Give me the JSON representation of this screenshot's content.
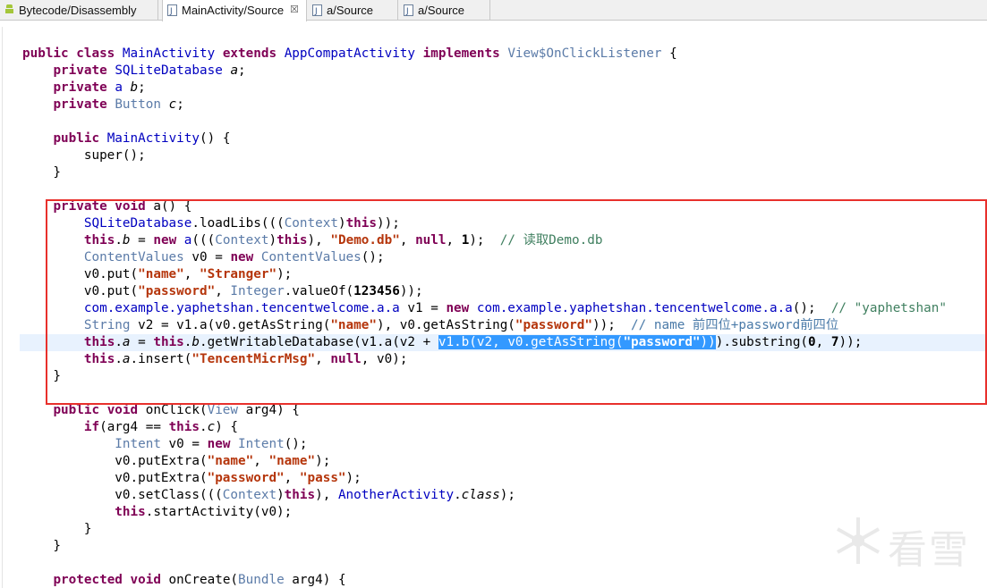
{
  "tabs": [
    {
      "label": "Bytecode/Disassembly",
      "icon": "android-icon"
    },
    {
      "label": "MainActivity/Source",
      "icon": "java-file-icon",
      "close": "☒"
    },
    {
      "label": "a/Source",
      "icon": "java-file-icon"
    },
    {
      "label": "a/Source",
      "icon": "java-file-icon"
    }
  ],
  "code": {
    "l1": [
      "public class",
      " ",
      "MainActivity",
      " ",
      "extends",
      " ",
      "AppCompatActivity",
      " ",
      "implements",
      " ",
      "View$OnClickListener",
      " {"
    ],
    "l2": [
      "    ",
      "private",
      " ",
      "SQLiteDatabase",
      " ",
      "a",
      ";"
    ],
    "l3": [
      "    ",
      "private",
      " ",
      "a",
      " ",
      "b",
      ";"
    ],
    "l4": [
      "    ",
      "private",
      " ",
      "Button",
      " ",
      "c",
      ";"
    ],
    "l5": [
      "    ",
      "public",
      " ",
      "MainActivity",
      "() {"
    ],
    "l6": [
      "        super();"
    ],
    "l7": [
      "    }"
    ],
    "l8": [
      "    ",
      "private void",
      " a() {"
    ],
    "l9": [
      "        ",
      "SQLiteDatabase",
      ".loadLibs(((",
      "Context",
      ")",
      "this",
      "));"
    ],
    "l10": [
      "        ",
      "this",
      ".",
      "b",
      " = ",
      "new",
      " ",
      "a",
      "(((",
      "Context",
      ")",
      "this",
      "), ",
      "\"Demo.db\"",
      ", ",
      "null",
      ", ",
      "1",
      ");  ",
      "// 读取Demo.db"
    ],
    "l11": [
      "        ",
      "ContentValues",
      " v0 = ",
      "new",
      " ",
      "ContentValues",
      "();"
    ],
    "l12": [
      "        v0.put(",
      "\"name\"",
      ", ",
      "\"Stranger\"",
      ");"
    ],
    "l13": [
      "        v0.put(",
      "\"password\"",
      ", ",
      "Integer",
      ".valueOf(",
      "123456",
      "));"
    ],
    "l14": [
      "        ",
      "com.example.yaphetshan.tencentwelcome.a.a",
      " v1 = ",
      "new",
      " ",
      "com.example.yaphetshan.tencentwelcome.a.a",
      "();  ",
      "// \"yaphetshan\""
    ],
    "l15": [
      "        ",
      "String",
      " v2 = v1.a(v0.getAsString(",
      "\"name\"",
      "), v0.getAsString(",
      "\"password\"",
      "));  ",
      "// name 前四位+password前四位"
    ],
    "l16": [
      "        ",
      "this",
      ".",
      "a",
      " = ",
      "this",
      ".",
      "b",
      ".getWritableDatabase(v1.a(v2 + ",
      "v1.b(v2, v0.getAsString(",
      "\"password\"",
      "))",
      ").substring(",
      "0",
      ", ",
      "7",
      "));"
    ],
    "l17": [
      "        ",
      "this",
      ".",
      "a",
      ".insert(",
      "\"TencentMicrMsg\"",
      ", ",
      "null",
      ", v0);"
    ],
    "l18": [
      "    }"
    ],
    "l19": [
      "    ",
      "public void",
      " onClick(",
      "View",
      " arg4) {"
    ],
    "l20": [
      "        ",
      "if",
      "(arg4 == ",
      "this",
      ".",
      "c",
      ") {"
    ],
    "l21": [
      "            ",
      "Intent",
      " v0 = ",
      "new",
      " ",
      "Intent",
      "();"
    ],
    "l22": [
      "            v0.putExtra(",
      "\"name\"",
      ", ",
      "\"name\"",
      ");"
    ],
    "l23": [
      "            v0.putExtra(",
      "\"password\"",
      ", ",
      "\"pass\"",
      ");"
    ],
    "l24": [
      "            v0.setClass(((",
      "Context",
      ")",
      "this",
      "), ",
      "AnotherActivity",
      ".",
      "class",
      ");"
    ],
    "l25": [
      "            ",
      "this",
      ".startActivity(v0);"
    ],
    "l26": [
      "        }"
    ],
    "l27": [
      "    }"
    ],
    "l28": [
      "    ",
      "protected void",
      " onCreate(",
      "Bundle",
      " arg4) {"
    ]
  },
  "watermark": {
    "text": "看雪",
    "icon": "snowflake-logo-icon"
  },
  "colors": {
    "keyword": "#7f0055",
    "type": "#0000c0",
    "string": "#2a00ff",
    "comment": "#3f7f5f",
    "selection": "#3399ff",
    "highlight_box": "#e8302c"
  }
}
